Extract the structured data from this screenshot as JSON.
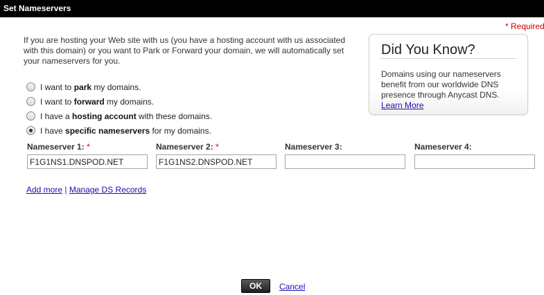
{
  "dialog": {
    "title": "Set Nameservers",
    "required_note": "* Required"
  },
  "intro_text": "If you are hosting your Web site with us (you have a hosting account with us associated with this domain) or you want to Park or Forward your domain, we will automatically set your nameservers for you.",
  "options": [
    {
      "before": "I want to ",
      "bold": "park",
      "after": " my domains.",
      "checked": false
    },
    {
      "before": "I want to ",
      "bold": "forward",
      "after": " my domains.",
      "checked": false
    },
    {
      "before": "I have a ",
      "bold": "hosting account",
      "after": " with these domains.",
      "checked": false
    },
    {
      "before": "I have ",
      "bold": "specific nameservers",
      "after": " for my domains.",
      "checked": true
    }
  ],
  "nameservers": [
    {
      "label": "Nameserver 1:",
      "required_mark": "*",
      "value": "F1G1NS1.DNSPOD.NET"
    },
    {
      "label": "Nameserver 2:",
      "required_mark": "*",
      "value": "F1G1NS2.DNSPOD.NET"
    },
    {
      "label": "Nameserver 3:",
      "required_mark": "",
      "value": ""
    },
    {
      "label": "Nameserver 4:",
      "required_mark": "",
      "value": ""
    }
  ],
  "links": {
    "add_more": "Add more",
    "separator": "|",
    "manage_ds": "Manage DS Records"
  },
  "did_you_know": {
    "title": "Did You Know?",
    "body": "Domains using our nameservers benefit from our worldwide DNS presence through Anycast DNS.",
    "link": "Learn More"
  },
  "buttons": {
    "ok": "OK",
    "cancel": "Cancel"
  },
  "colors": {
    "titlebar_bg": "#000000",
    "required": "#cc0000",
    "link": "#1a0dab"
  }
}
